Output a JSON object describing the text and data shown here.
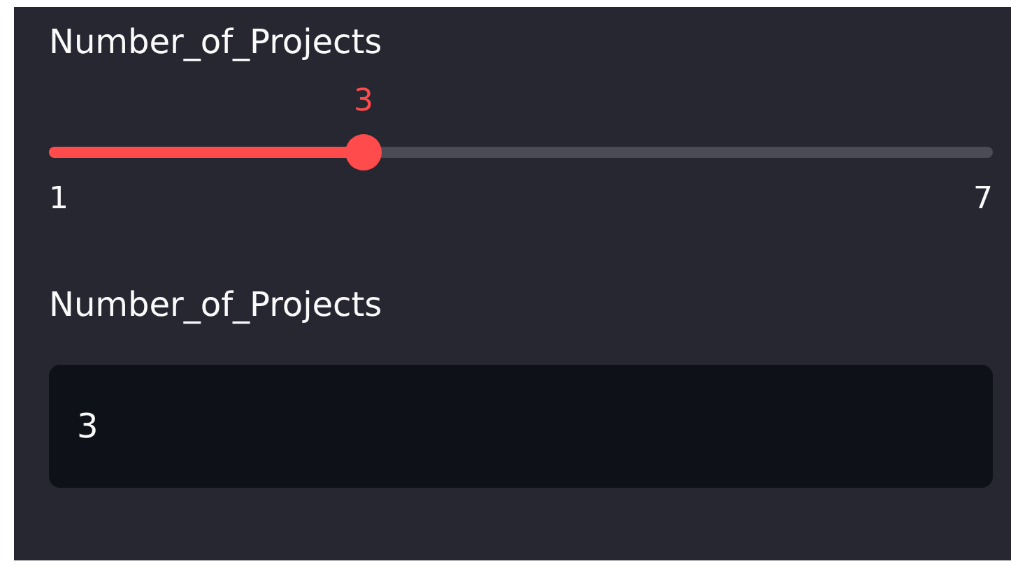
{
  "slider": {
    "label": "Number_of_Projects",
    "value": "3",
    "min": "1",
    "max": "7",
    "level": 0.3333
  },
  "number_input": {
    "label": "Number_of_Projects",
    "value": "3"
  }
}
